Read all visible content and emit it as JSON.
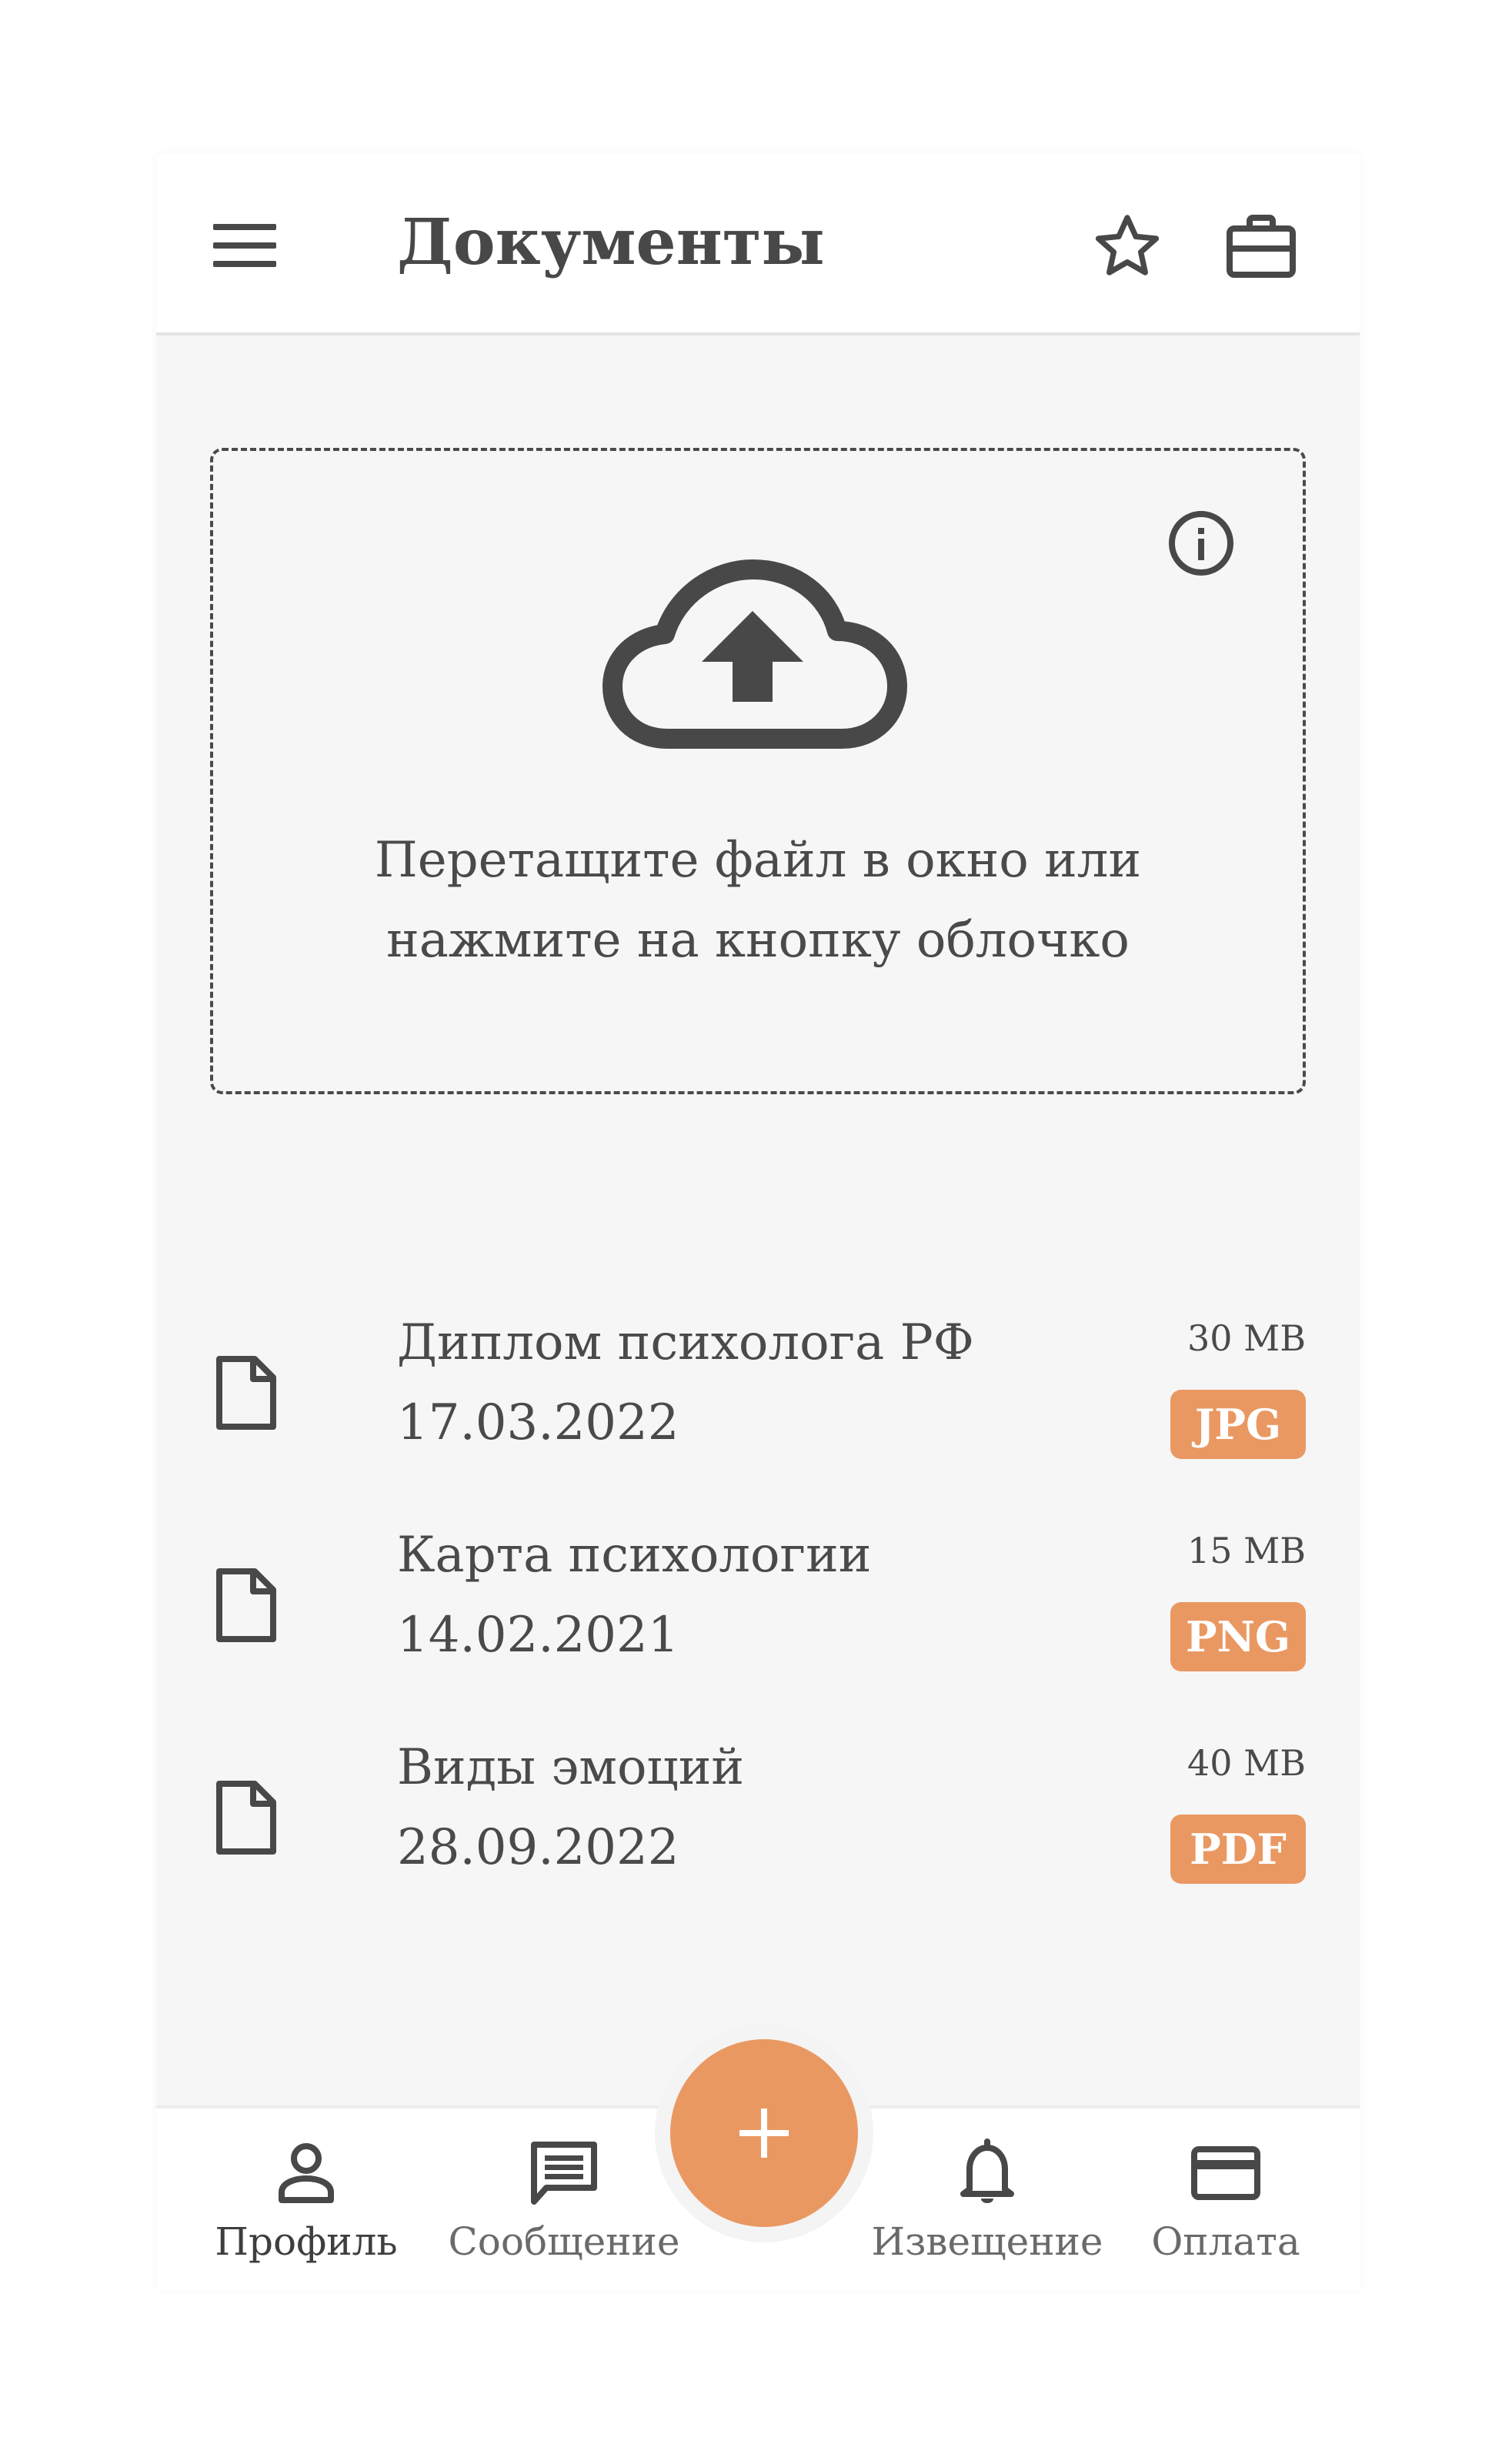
{
  "header": {
    "title": "Документы",
    "menu_icon": "hamburger-menu-icon",
    "favorite_icon": "star-icon",
    "portfolio_icon": "briefcase-icon"
  },
  "upload": {
    "line1": "Перетащите файл в окно или",
    "line2": "нажмите на кнопку облочко",
    "cloud_icon": "cloud-upload-icon",
    "info_icon": "info-icon"
  },
  "files": [
    {
      "name": "Диплом психолога РФ",
      "date": "17.03.2022",
      "size": "30 MB",
      "type": "JPG",
      "icon": "file-icon"
    },
    {
      "name": "Карта психологии",
      "date": "14.02.2021",
      "size": "15 MB",
      "type": "PNG",
      "icon": "file-icon"
    },
    {
      "name": "Виды эмоций",
      "date": "28.09.2022",
      "size": "40 MB",
      "type": "PDF",
      "icon": "file-icon"
    }
  ],
  "nav": {
    "profile": "Профиль",
    "messages": "Сообщение",
    "notifications": "Извещение",
    "payment": "Оплата",
    "fab_icon": "plus-icon"
  },
  "colors": {
    "accent": "#ea9862",
    "icon": "#484848",
    "background": "#f6f6f6",
    "surface": "#ffffff"
  }
}
